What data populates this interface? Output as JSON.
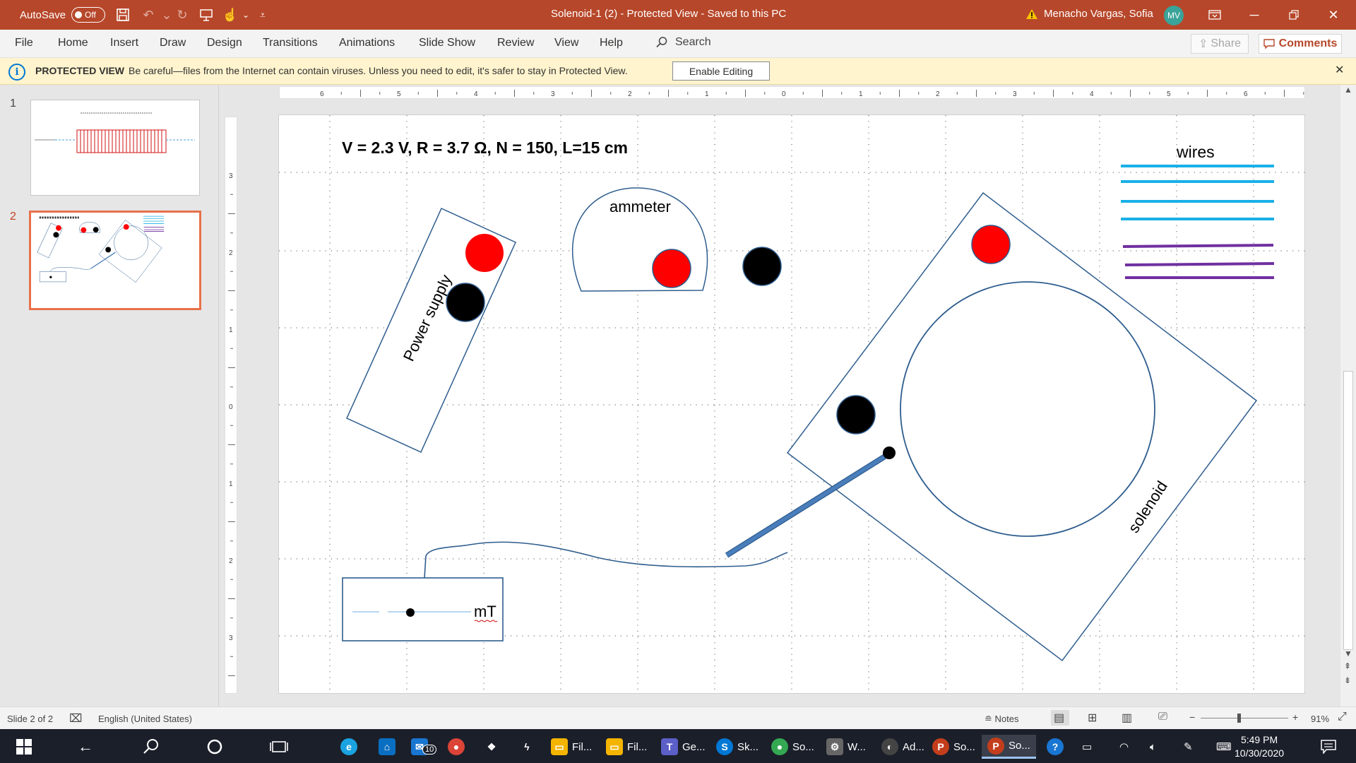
{
  "titlebar": {
    "autosave_label": "AutoSave",
    "autosave_state": "Off",
    "document_title": "Solenoid-1 (2)  -  Protected View  -  Saved to this PC",
    "user_name": "Menacho Vargas, Sofia",
    "user_initials": "MV"
  },
  "ribbon": {
    "tabs": [
      "File",
      "Home",
      "Insert",
      "Draw",
      "Design",
      "Transitions",
      "Animations",
      "Slide Show",
      "Review",
      "View",
      "Help"
    ],
    "search_label": "Search",
    "share_label": "Share",
    "comments_label": "Comments"
  },
  "protected_view": {
    "title": "PROTECTED VIEW",
    "message": "Be careful—files from the Internet can contain viruses. Unless you need to edit, it's safer to stay in Protected View.",
    "button_label": "Enable Editing"
  },
  "thumbnails": [
    {
      "number": "1"
    },
    {
      "number": "2"
    }
  ],
  "slide": {
    "heading": "V = 2.3 V, R = 3.7 Ω, N = 150, L=15 cm",
    "power_supply_label": "Power supply",
    "ammeter_label": "ammeter",
    "wires_label": "wires",
    "solenoid_label": "solenoid",
    "meter_unit_label": "mT"
  },
  "ruler": {
    "horizontal_ticks": [
      "6",
      "5",
      "4",
      "3",
      "2",
      "1",
      "0",
      "1",
      "2",
      "3",
      "4",
      "5",
      "6"
    ],
    "vertical_ticks": [
      "3",
      "2",
      "1",
      "0",
      "1",
      "2",
      "3"
    ]
  },
  "statusbar": {
    "slide_info": "Slide 2 of 2",
    "language": "English (United States)",
    "notes_label": "Notes",
    "zoom": "91%"
  },
  "taskbar": {
    "items": [
      {
        "label": "Fil...",
        "icon": "file-explorer-icon",
        "color": "#f4b400"
      },
      {
        "label": "Fil...",
        "icon": "file-explorer-icon",
        "color": "#f4b400"
      },
      {
        "label": "Ge...",
        "icon": "teams-icon",
        "color": "#5b5fc7"
      },
      {
        "label": "Sk...",
        "icon": "skype-icon",
        "color": "#0078d4"
      },
      {
        "label": "So...",
        "icon": "chrome-icon",
        "color": "#34a853"
      },
      {
        "label": "W...",
        "icon": "wireshark-icon",
        "color": "#888888"
      },
      {
        "label": "Ad...",
        "icon": "app-icon",
        "color": "#555555"
      },
      {
        "label": "So...",
        "icon": "powerpoint-icon",
        "color": "#c43e1c"
      },
      {
        "label": "So...",
        "icon": "powerpoint-icon",
        "color": "#c43e1c"
      }
    ],
    "mail_badge": "10",
    "time": "5:49 PM",
    "date": "10/30/2020"
  },
  "colors": {
    "accent": "#b7472a",
    "wire_blue": "#1ab0e8",
    "wire_purple": "#7030a0",
    "terminal_red": "#ff0000",
    "terminal_black": "#000000",
    "shape_outline": "#2e5d8e"
  }
}
